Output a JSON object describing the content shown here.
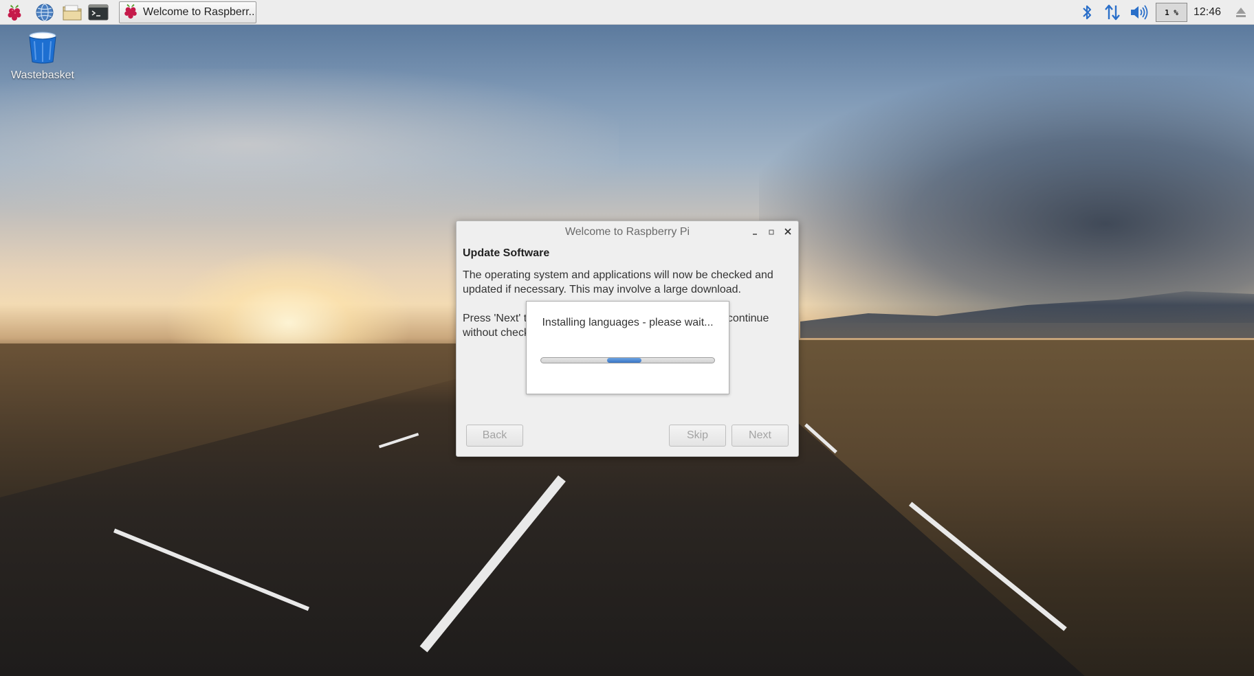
{
  "taskbar": {
    "launchers": [
      {
        "icon": "raspberry-menu-icon"
      },
      {
        "icon": "web-browser-icon"
      },
      {
        "icon": "file-manager-icon"
      },
      {
        "icon": "terminal-icon"
      }
    ],
    "task_label": "Welcome to Raspberr...",
    "cpu_usage": "1 %",
    "clock": "12:46",
    "tray_icons": [
      "bluetooth-icon",
      "network-icon",
      "volume-icon",
      "eject-icon"
    ]
  },
  "desktop": {
    "icons": [
      {
        "label": "Wastebasket",
        "icon": "wastebasket-icon"
      }
    ]
  },
  "dialog": {
    "title": "Welcome to Raspberry Pi",
    "heading": "Update Software",
    "paragraph1": "The operating system and applications will now be checked and updated if necessary. This may involve a large download.",
    "paragraph2": "Press 'Next' to check and update software, or 'Skip' to continue without checking.",
    "buttons": {
      "back": "Back",
      "skip": "Skip",
      "next": "Next"
    },
    "buttons_enabled": false
  },
  "progress": {
    "message": "Installing languages - please wait...",
    "indeterminate": true,
    "pulse_start": 0.38,
    "pulse_width": 0.2
  },
  "colors": {
    "taskbar_bg": "#ededed",
    "dialog_bg": "#efefef",
    "progress_fill": "#3874c4",
    "disabled_text": "#a3a3a3"
  }
}
